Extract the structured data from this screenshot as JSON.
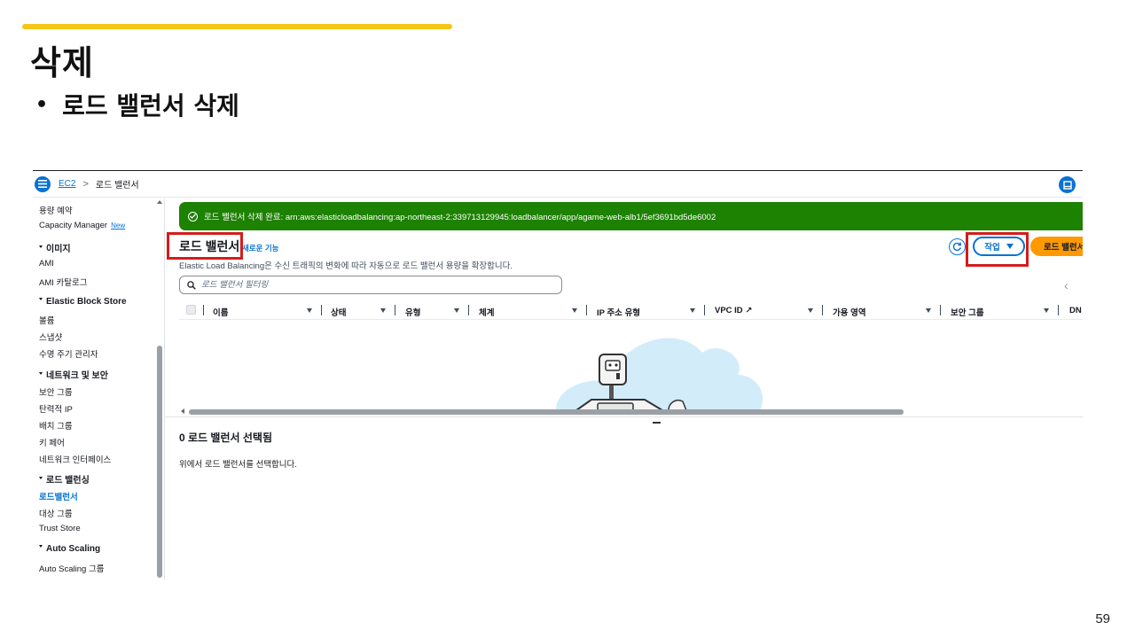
{
  "slide": {
    "title": "삭제",
    "bullet": "로드 밸런서 삭제",
    "page_number": "59",
    "accent_color": "#f5c518"
  },
  "topbar": {
    "menu_icon": "hamburger-icon",
    "breadcrumb": [
      "EC2",
      "로드 밸런서"
    ],
    "breadcrumb_separator": ">",
    "panel_icon": "panel-icon"
  },
  "sidebar": {
    "items": [
      {
        "type": "item",
        "label": "용량 예약"
      },
      {
        "type": "item",
        "label": "Capacity Manager",
        "badge": "New"
      },
      {
        "type": "head",
        "label": "이미지"
      },
      {
        "type": "item",
        "label": "AMI"
      },
      {
        "type": "item",
        "label": "AMI 카탈로그"
      },
      {
        "type": "head",
        "label": "Elastic Block Store"
      },
      {
        "type": "item",
        "label": "볼륨"
      },
      {
        "type": "item",
        "label": "스냅샷"
      },
      {
        "type": "item",
        "label": "수명 주기 관리자"
      },
      {
        "type": "head",
        "label": "네트워크 및 보안"
      },
      {
        "type": "item",
        "label": "보안 그룹"
      },
      {
        "type": "item",
        "label": "탄력적 IP"
      },
      {
        "type": "item",
        "label": "배치 그룹"
      },
      {
        "type": "item",
        "label": "키 페어"
      },
      {
        "type": "item",
        "label": "네트워크 인터페이스"
      },
      {
        "type": "head",
        "label": "로드 밸런싱"
      },
      {
        "type": "item",
        "label": "로드밸런서",
        "active": true
      },
      {
        "type": "item",
        "label": "대상 그룹"
      },
      {
        "type": "item",
        "label": "Trust Store"
      },
      {
        "type": "head",
        "label": "Auto Scaling"
      },
      {
        "type": "item",
        "label": "Auto Scaling 그룹"
      }
    ]
  },
  "flash": {
    "status": "success",
    "color": "#1d8102",
    "message": "로드 밸런서 삭제 완료: arn:aws:elasticloadbalancing:ap-northeast-2:339713129945:loadbalancer/app/agame-web-alb1/5ef3691bd5de6002"
  },
  "main": {
    "title": "로드 밸런서",
    "new_feature_link": "새로운 기능",
    "description": "Elastic Load Balancing은 수신 트래픽의 변화에 따라 자동으로 로드 밸런서 용량을 확장합니다.",
    "actions_label": "작업",
    "create_label": "로드 밸런서 생성",
    "search_placeholder": "로드 밸런서 필터링",
    "columns": [
      "이름",
      "상태",
      "유형",
      "체계",
      "IP 주소 유형",
      "VPC ID",
      "가용 영역",
      "보안 그룹",
      "DN"
    ],
    "highlight_color": "#d41c1c"
  },
  "bottom_panel": {
    "title": "0 로드 밸런서 선택됨",
    "description": "위에서 로드 밸런서를 선택합니다."
  }
}
